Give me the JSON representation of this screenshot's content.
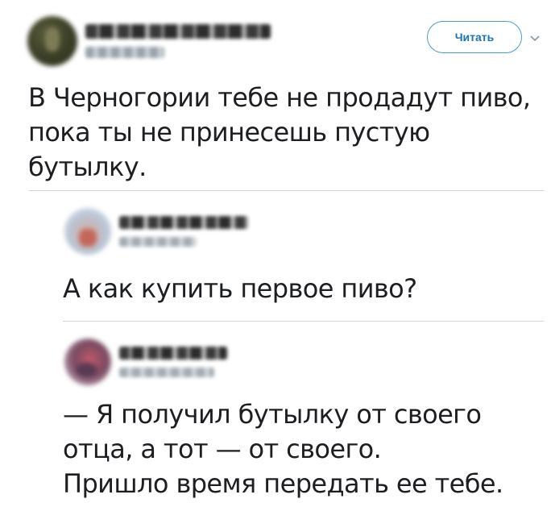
{
  "tweet": {
    "follow_label": "Читать",
    "lines": [
      "В Черногории тебе не продадут пиво,",
      "пока ты не принесешь пустую",
      "бутылку."
    ]
  },
  "replies": [
    {
      "lines": [
        "А как купить первое пиво?"
      ]
    },
    {
      "lines": [
        "— Я получил бутылку от своего",
        "отца, а тот — от своего.",
        "Пришло время передать ее тебе."
      ]
    }
  ],
  "colors": {
    "accent": "#1b74b8",
    "button_border": "#4a9cd6",
    "divider": "#cfd6dc",
    "text": "#1c1e21"
  },
  "icons": {
    "dropdown": "chevron-down-icon"
  }
}
